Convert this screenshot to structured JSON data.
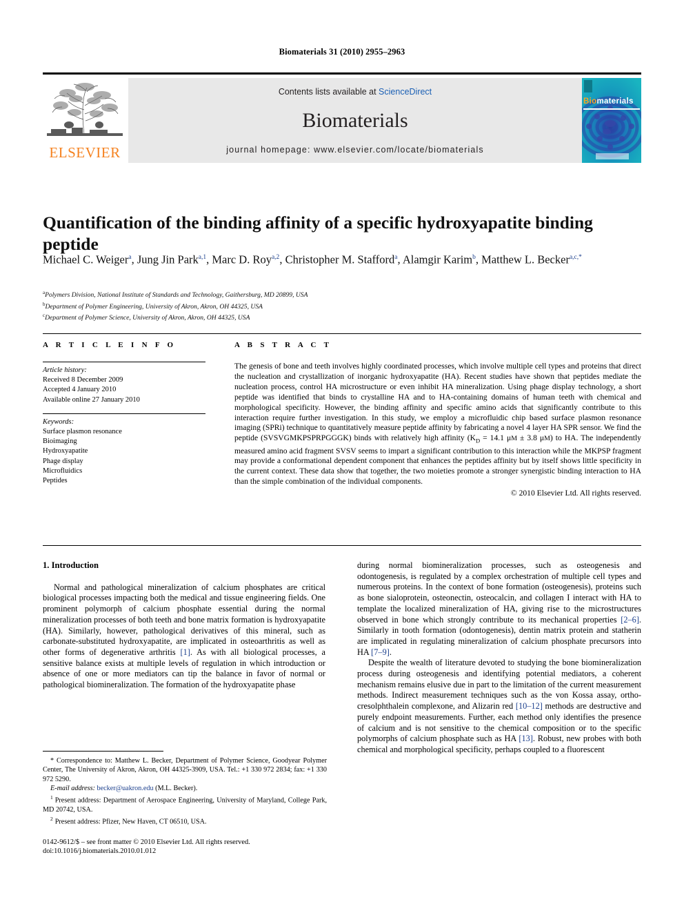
{
  "running_head": "Biomaterials 31 (2010) 2955–2963",
  "masthead": {
    "publisher": "ELSEVIER",
    "contents_prefix": "Contents lists available at ",
    "contents_link": "ScienceDirect",
    "journal_name": "Biomaterials",
    "homepage": "journal homepage: www.elsevier.com/locate/biomaterials",
    "cover": {
      "title_bio": "Bio",
      "title_materials": "materials"
    },
    "accent_orange": "#F58220",
    "link_blue": "#1a5fb4",
    "cover_teal": "#17a8b8"
  },
  "article": {
    "title": "Quantification of the binding affinity of a specific hydroxyapatite binding peptide",
    "authors_html": "Michael C. Weiger<sup>a</sup>, Jung Jin Park<sup>a,1</sup>, Marc D. Roy<sup>a,2</sup>, Christopher M. Stafford<sup>a</sup>, Alamgir Karim<sup>b</sup>, Matthew L. Becker<sup>a,c,*</sup>",
    "affiliations": [
      {
        "marker": "a",
        "text": "Polymers Division, National Institute of Standards and Technology, Gaithersburg, MD 20899, USA"
      },
      {
        "marker": "b",
        "text": "Department of Polymer Engineering, University of Akron, Akron, OH 44325, USA"
      },
      {
        "marker": "c",
        "text": "Department of Polymer Science, University of Akron, Akron, OH 44325, USA"
      }
    ]
  },
  "sections": {
    "article_info_heading": "A R T I C L E  I N F O",
    "abstract_heading": "A B S T R A C T"
  },
  "article_info": {
    "history_label": "Article history:",
    "history": [
      "Received 8 December 2009",
      "Accepted 4 January 2010",
      "Available online 27 January 2010"
    ],
    "keywords_label": "Keywords:",
    "keywords": [
      "Surface plasmon resonance",
      "Bioimaging",
      "Hydroxyapatite",
      "Phage display",
      "Microfluidics",
      "Peptides"
    ]
  },
  "abstract": {
    "text_html": "The genesis of bone and teeth involves highly coordinated processes, which involve multiple cell types and proteins that direct the nucleation and crystallization of inorganic hydroxyapatite (HA). Recent studies have shown that peptides mediate the nucleation process, control HA microstructure or even inhibit HA mineralization. Using phage display technology, a short peptide was identified that binds to crystalline HA and to HA-containing domains of human teeth with chemical and morphological specificity. However, the binding affinity and specific amino acids that significantly contribute to this interaction require further investigation. In this study, we employ a microfluidic chip based surface plasmon resonance imaging (SPRi) technique to quantitatively measure peptide affinity by fabricating a novel 4 layer HA SPR sensor. We find the peptide (SVSVGMKPSPRPGGGK) binds with relatively high affinity (K<sub>D</sub> = 14.1 &#956;<span style=\"font-size:0.85em\">M</span> &#177; 3.8 &#956;<span style=\"font-size:0.85em\">M</span>) to HA. The independently measured amino acid fragment SVSV seems to impart a significant contribution to this interaction while the MKPSP fragment may provide a conformational dependent component that enhances the peptides affinity but by itself shows little specificity in the current context. These data show that together, the two moieties promote a stronger synergistic binding interaction to HA than the simple combination of the individual components.",
    "copyright": "© 2010 Elsevier Ltd. All rights reserved."
  },
  "introduction": {
    "heading": "1. Introduction",
    "left_paragraphs_html": [
      "Normal and pathological mineralization of calcium phosphates are critical biological processes impacting both the medical and tissue engineering fields. One prominent polymorph of calcium phosphate essential during the normal mineralization processes of both teeth and bone matrix formation is hydroxyapatite (HA). Similarly, however, pathological derivatives of this mineral, such as carbonate-substituted hydroxyapatite, are implicated in osteoarthritis as well as other forms of degenerative arthritis <span class=\"ref\">[1]</span>. As with all biological processes, a sensitive balance exists at multiple levels of regulation in which introduction or absence of one or more mediators can tip the balance in favor of normal or pathological biomineralization. The formation of the hydroxyapatite phase"
    ],
    "right_paragraphs_html": [
      "during normal biomineralization processes, such as osteogenesis and odontogenesis, is regulated by a complex orchestration of multiple cell types and numerous proteins. In the context of bone formation (osteogenesis), proteins such as bone sialoprotein, osteonectin, osteocalcin, and collagen I interact with HA to template the localized mineralization of HA, giving rise to the microstructures observed in bone which strongly contribute to its mechanical properties <span class=\"ref\">[2&#8211;6]</span>. Similarly in tooth formation (odontogenesis), dentin matrix protein and statherin are implicated in regulating mineralization of calcium phosphate precursors into HA <span class=\"ref\">[7&#8211;9]</span>.",
      "Despite the wealth of literature devoted to studying the bone biomineralization process during osteogenesis and identifying potential mediators, a coherent mechanism remains elusive due in part to the limitation of the current measurement methods. Indirect measurement techniques such as the von Kossa assay, ortho-cresolphthalein complexone, and Alizarin red <span class=\"ref\">[10&#8211;12]</span> methods are destructive and purely endpoint measurements. Further, each method only identifies the presence of calcium and is not sensitive to the chemical composition or to the specific polymorphs of calcium phosphate such as HA <span class=\"ref\">[13]</span>. Robust, new probes with both chemical and morphological specificity, perhaps coupled to a fluorescent"
    ]
  },
  "footnotes": {
    "correspondence_html": "* Correspondence to: Matthew L. Becker, Department of Polymer Science, Goodyear Polymer Center, The University of Akron, Akron, OH 44325-3909, USA. Tel.: +1 330 972 2834; fax: +1 330 972 5290.",
    "email_label": "E-mail address:",
    "email_address": "becker@uakron.edu",
    "email_suffix": "(M.L. Becker).",
    "note1_marker": "1",
    "note1_text": "Present address: Department of Aerospace Engineering, University of Maryland, College Park, MD 20742, USA.",
    "note2_marker": "2",
    "note2_text": "Present address: Pfizer, New Haven, CT 06510, USA."
  },
  "colophon": {
    "issn_line": "0142-9612/$ – see front matter © 2010 Elsevier Ltd. All rights reserved.",
    "doi_line": "doi:10.1016/j.biomaterials.2010.01.012"
  }
}
